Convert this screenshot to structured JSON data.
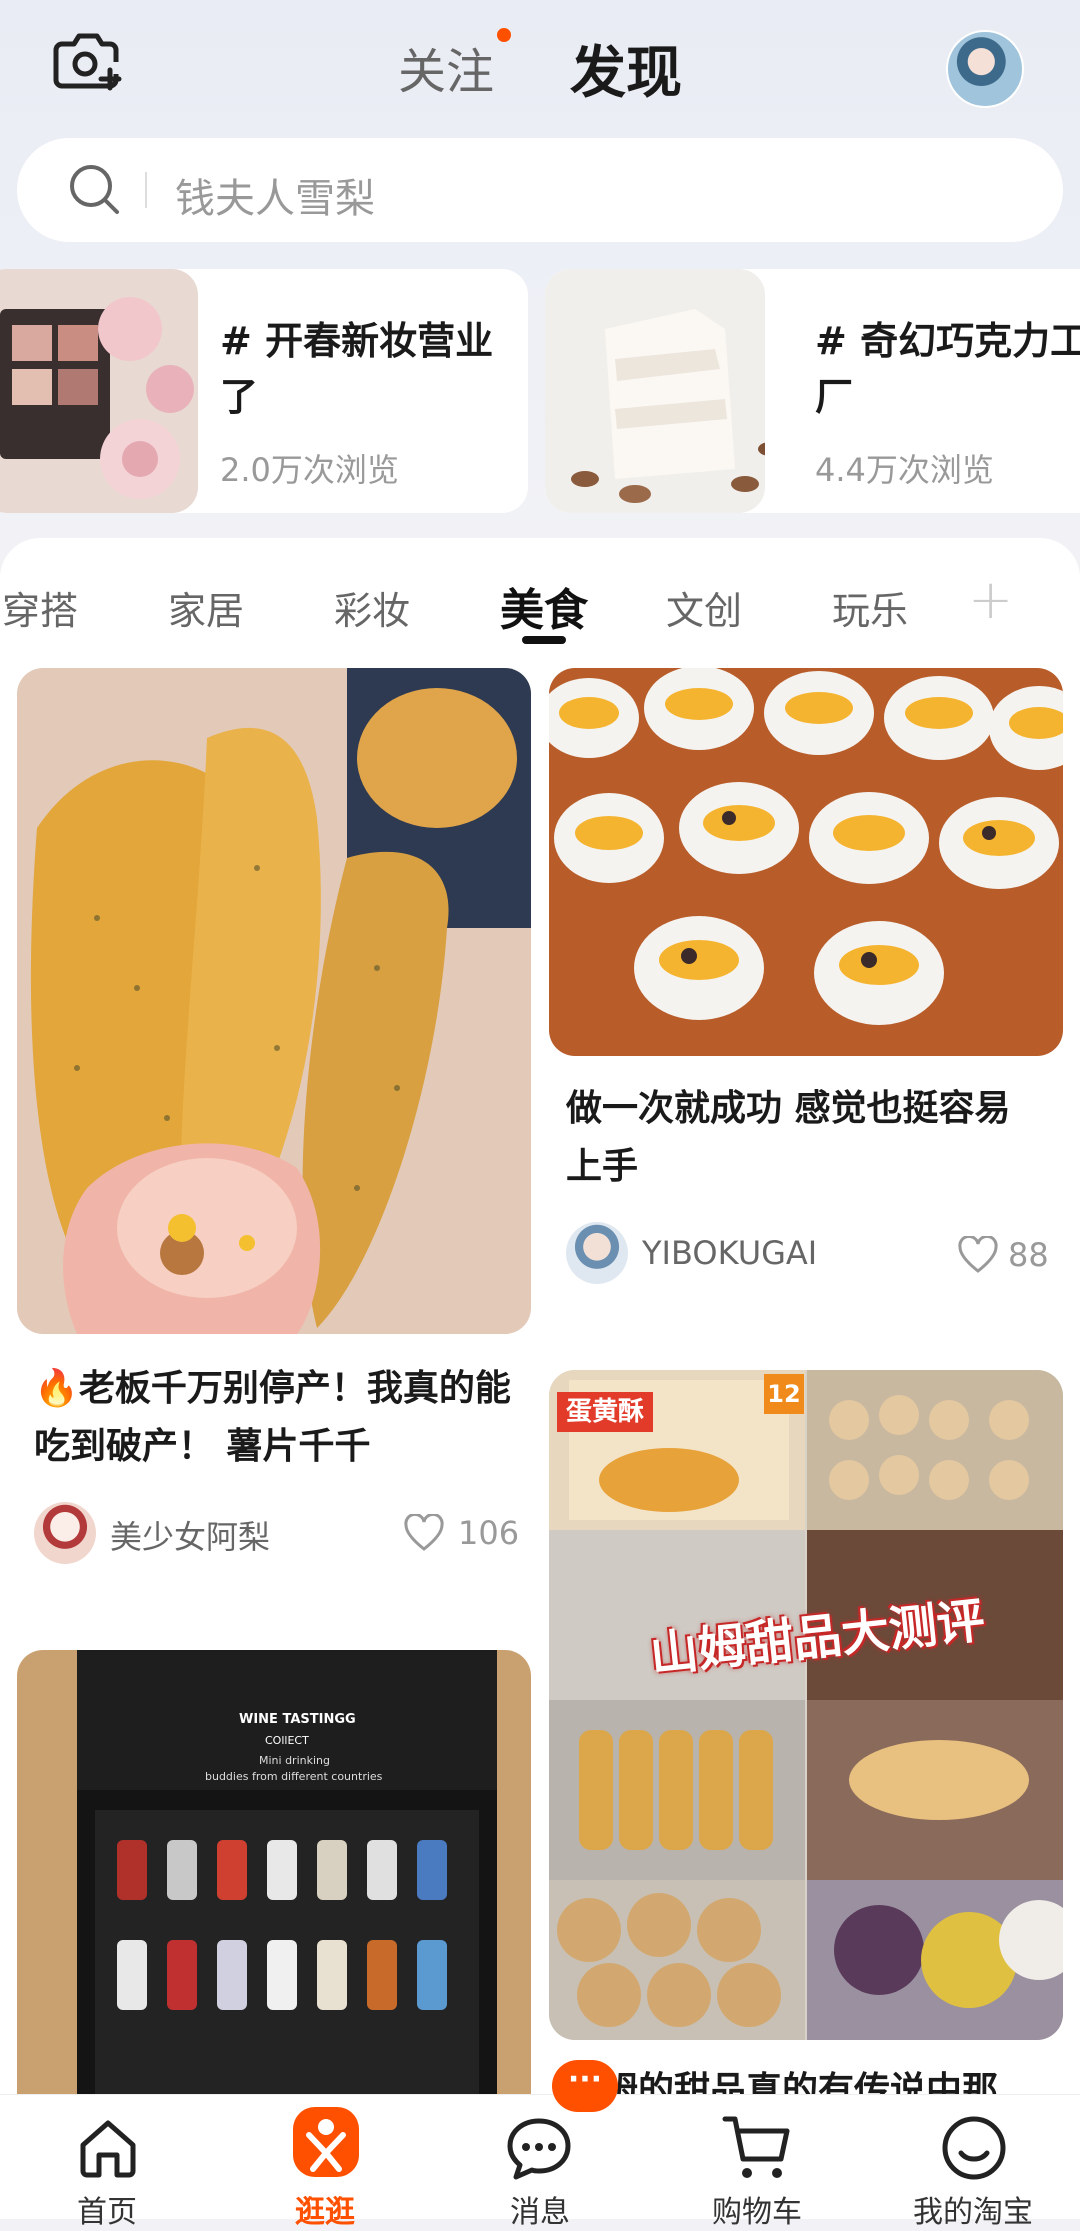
{
  "header": {
    "tab_follow": "关注",
    "tab_discover": "发现",
    "icons": {
      "camera": "camera-plus-icon",
      "avatar": "user-avatar"
    }
  },
  "search": {
    "placeholder": "钱夫人雪梨",
    "icon": "search-icon"
  },
  "topics": [
    {
      "title": "# 开春新妆营业了",
      "views": "2.0万次浏览"
    },
    {
      "title": "# 奇幻巧克力工厂",
      "views": "4.4万次浏览"
    }
  ],
  "categories": [
    "穿搭",
    "家居",
    "彩妆",
    "美食",
    "文创",
    "玩乐"
  ],
  "active_category": "美食",
  "feed": {
    "card1": {
      "title": "🔥老板千万别停产！我真的能吃到破产！ 薯片千千",
      "author": "美少女阿梨",
      "likes": "106"
    },
    "card2": {
      "title": "做一次就成功 感觉也挺容易上手",
      "author": "YIBOKUGAI",
      "likes": "88"
    },
    "card3": {
      "overlay": "山姆甜品大测评",
      "title": "山姆的甜品真的有传说中那",
      "sticker": "蛋黄酥",
      "sticker_num": "12"
    },
    "card4": {
      "box_title": "WINE TASTINGG",
      "box_line1": "COllECT",
      "box_line2": "Mini drinking",
      "box_line3": "buddies from different countries"
    }
  },
  "bottom_nav": [
    {
      "label": "首页",
      "icon": "home-icon"
    },
    {
      "label": "逛逛",
      "icon": "guangguang-icon"
    },
    {
      "label": "消息",
      "icon": "chat-bubble-icon"
    },
    {
      "label": "购物车",
      "icon": "cart-icon"
    },
    {
      "label": "我的淘宝",
      "icon": "smile-icon"
    }
  ],
  "active_nav": "逛逛",
  "badges": {
    "message": "···"
  },
  "colors": {
    "accent": "#ff5000",
    "text": "#1a1a1a",
    "muted": "#999999"
  }
}
